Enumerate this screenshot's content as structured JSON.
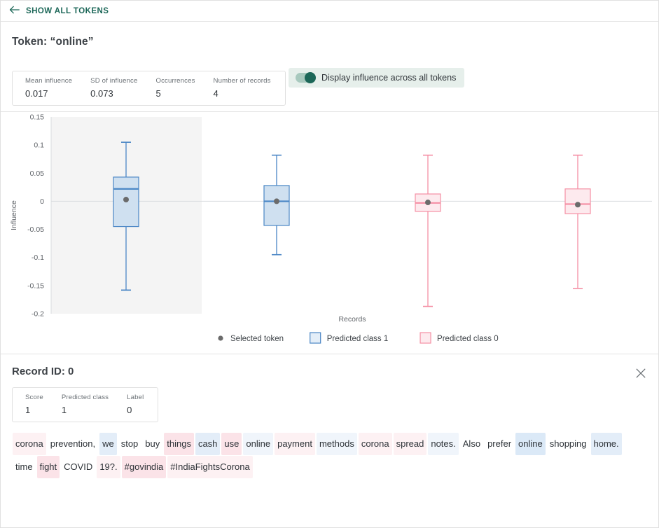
{
  "topbar": {
    "back_label": "SHOW ALL TOKENS",
    "back_icon": "arrow-left-icon",
    "accent": "#1c6758"
  },
  "token_panel": {
    "title": "Token: “online”",
    "stats": [
      {
        "label": "Mean influence",
        "value": "0.017"
      },
      {
        "label": "SD of influence",
        "value": "0.073"
      },
      {
        "label": "Occurrences",
        "value": "5"
      },
      {
        "label": "Number of records",
        "value": "4"
      }
    ],
    "toggle": {
      "label": "Display influence across all tokens",
      "state": "on"
    }
  },
  "chart_data": {
    "type": "box",
    "title": "",
    "xlabel": "Records",
    "ylabel": "Influence",
    "ylim": [
      -0.2,
      0.15
    ],
    "yticks": [
      0.15,
      0.1,
      0.05,
      0,
      -0.05,
      -0.1,
      -0.15,
      -0.2
    ],
    "ytick_labels": [
      "0.15",
      "0.1",
      "0.05",
      "0",
      "-0.05",
      "-0.1",
      "-0.15",
      "-0.2"
    ],
    "xticks": [],
    "xtick_labels": [],
    "grid": false,
    "zero_line": 0,
    "highlight_band": {
      "from_index": 0,
      "to_index": 0,
      "color": "#f4f4f4"
    },
    "colors": {
      "class1_stroke": "#4a86c5",
      "class1_fill": "#cfe0f0",
      "class0_stroke": "#f58fa4",
      "class0_fill": "#fdeaee",
      "point": "#6b6b6b",
      "axis": "#9aa0a6"
    },
    "boxes": [
      {
        "record": "0",
        "predicted_class": 1,
        "selected": true,
        "whisker_high": 0.105,
        "q3": 0.043,
        "median": 0.022,
        "q1": -0.045,
        "whisker_low": -0.158,
        "point": 0.003
      },
      {
        "record": "1",
        "predicted_class": 1,
        "selected": false,
        "whisker_high": 0.082,
        "q3": 0.028,
        "median": 0.0,
        "q1": -0.043,
        "whisker_low": -0.095,
        "point": 0.0
      },
      {
        "record": "2",
        "predicted_class": 0,
        "selected": false,
        "whisker_high": 0.082,
        "q3": 0.013,
        "median": -0.003,
        "q1": -0.018,
        "whisker_low": -0.187,
        "point": -0.002
      },
      {
        "record": "3",
        "predicted_class": 0,
        "selected": false,
        "whisker_high": 0.082,
        "q3": 0.022,
        "median": -0.005,
        "q1": -0.022,
        "whisker_low": -0.155,
        "point": -0.006
      }
    ],
    "legend": {
      "position": "bottom",
      "entries": [
        {
          "label": "Selected token",
          "marker": "dot",
          "color": "#6b6b6b"
        },
        {
          "label": "Predicted class 1",
          "marker": "square",
          "color": "#4a86c5",
          "fill": "#e4eef8"
        },
        {
          "label": "Predicted class 0",
          "marker": "square",
          "color": "#f58fa4",
          "fill": "#fdeaee"
        }
      ]
    }
  },
  "record_panel": {
    "title": "Record ID: 0",
    "close_icon": "close-icon",
    "stats": [
      {
        "label": "Score",
        "value": "1"
      },
      {
        "label": "Predicted class",
        "value": "1"
      },
      {
        "label": "Label",
        "value": "0"
      }
    ],
    "tokens": [
      {
        "text": "corona",
        "hl": "pink-1"
      },
      {
        "text": "prevention,",
        "hl": "none"
      },
      {
        "text": "we",
        "hl": "blue-2"
      },
      {
        "text": "stop",
        "hl": "none"
      },
      {
        "text": "buy",
        "hl": "none"
      },
      {
        "text": "things",
        "hl": "pink-2"
      },
      {
        "text": "cash",
        "hl": "blue-2"
      },
      {
        "text": "use",
        "hl": "pink-2"
      },
      {
        "text": "online",
        "hl": "blue-1"
      },
      {
        "text": "payment",
        "hl": "pink-1"
      },
      {
        "text": "methods",
        "hl": "blue-1"
      },
      {
        "text": "corona",
        "hl": "pink-1"
      },
      {
        "text": "spread",
        "hl": "pink-1"
      },
      {
        "text": "notes.",
        "hl": "blue-1"
      },
      {
        "text": "Also",
        "hl": "none"
      },
      {
        "text": "prefer",
        "hl": "none"
      },
      {
        "text": "online",
        "hl": "blue-3"
      },
      {
        "text": "shopping",
        "hl": "none"
      },
      {
        "text": "home.",
        "hl": "blue-2"
      },
      {
        "text": "time",
        "hl": "none"
      },
      {
        "text": "fight",
        "hl": "pink-2"
      },
      {
        "text": "COVID",
        "hl": "none"
      },
      {
        "text": "19?.",
        "hl": "pink-1"
      },
      {
        "text": "#govindia",
        "hl": "pink-2"
      },
      {
        "text": "#IndiaFightsCorona",
        "hl": "pink-1"
      }
    ],
    "highlight_colors": {
      "none": "transparent",
      "blue-1": "#f0f5fb",
      "blue-2": "#e3edf8",
      "blue-3": "#dbe9f7",
      "pink-1": "#fdf1f3",
      "pink-2": "#fbe3e8"
    }
  }
}
